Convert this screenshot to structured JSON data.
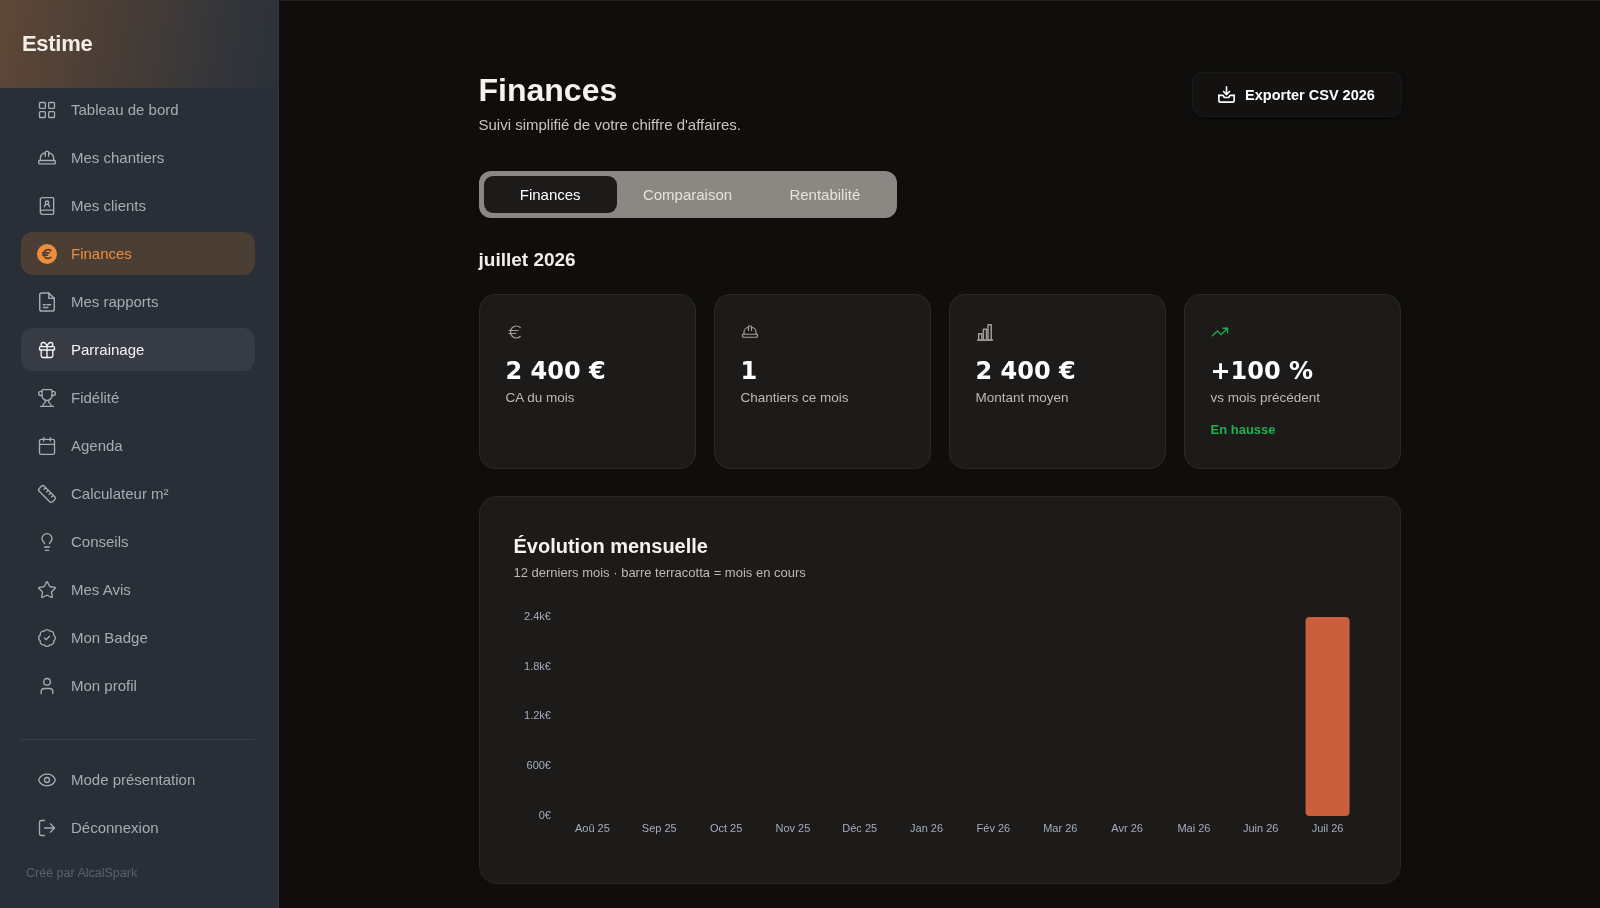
{
  "sidebar": {
    "brand": "Estime",
    "items": [
      {
        "label": "Tableau de bord",
        "selected": false,
        "highlighted": false
      },
      {
        "label": "Mes chantiers",
        "selected": false,
        "highlighted": false
      },
      {
        "label": "Mes clients",
        "selected": false,
        "highlighted": false
      },
      {
        "label": "Finances",
        "selected": true,
        "highlighted": false
      },
      {
        "label": "Mes rapports",
        "selected": false,
        "highlighted": false
      },
      {
        "label": "Parrainage",
        "selected": false,
        "highlighted": true
      },
      {
        "label": "Fidélité",
        "selected": false,
        "highlighted": false
      },
      {
        "label": "Agenda",
        "selected": false,
        "highlighted": false
      },
      {
        "label": "Calculateur m²",
        "selected": false,
        "highlighted": false
      },
      {
        "label": "Conseils",
        "selected": false,
        "highlighted": false
      },
      {
        "label": "Mes Avis",
        "selected": false,
        "highlighted": false
      },
      {
        "label": "Mon Badge",
        "selected": false,
        "highlighted": false
      },
      {
        "label": "Mon profil",
        "selected": false,
        "highlighted": false
      }
    ],
    "footer_items": [
      {
        "label": "Mode présentation"
      },
      {
        "label": "Déconnexion"
      }
    ],
    "credit": "Créé par AlcalSpark"
  },
  "header": {
    "title": "Finances",
    "subtitle": "Suivi simplifié de votre chiffre d'affaires.",
    "export_button": "Exporter CSV 2026"
  },
  "tabs": [
    {
      "label": "Finances",
      "selected": true
    },
    {
      "label": "Comparaison",
      "selected": false
    },
    {
      "label": "Rentabilité",
      "selected": false
    }
  ],
  "period": "juillet 2026",
  "stats": [
    {
      "kind": "plain",
      "value": "2 400 €",
      "label": "CA du mois"
    },
    {
      "kind": "plain",
      "value": "1",
      "label": "Chantiers ce mois"
    },
    {
      "kind": "plain",
      "value": "2 400 €",
      "label": "Montant moyen"
    },
    {
      "kind": "rise",
      "value": "+100 %",
      "label": "vs mois précédent",
      "note": "En hausse"
    }
  ],
  "monthly_chart": {
    "chart_data": {
      "type": "bar",
      "title": "Évolution mensuelle",
      "subtitle": "12 derniers mois · barre terracotta = mois en cours",
      "categories": [
        "Aoû 25",
        "Sep 25",
        "Oct 25",
        "Nov 25",
        "Déc 25",
        "Jan 26",
        "Fév 26",
        "Mar 26",
        "Avr 26",
        "Mai 26",
        "Juin 26",
        "Juil 26"
      ],
      "values": [
        0,
        0,
        0,
        0,
        0,
        0,
        0,
        0,
        0,
        0,
        0,
        2400
      ],
      "color": "#c95f3c",
      "ylim": [
        0,
        2400
      ],
      "yticks": [
        {
          "value": 0,
          "label": "0€"
        },
        {
          "value": 600,
          "label": "600€"
        },
        {
          "value": 1200,
          "label": "1.2k€"
        },
        {
          "value": 1800,
          "label": "1.8k€"
        },
        {
          "value": 2400,
          "label": "2.4k€"
        }
      ]
    }
  }
}
